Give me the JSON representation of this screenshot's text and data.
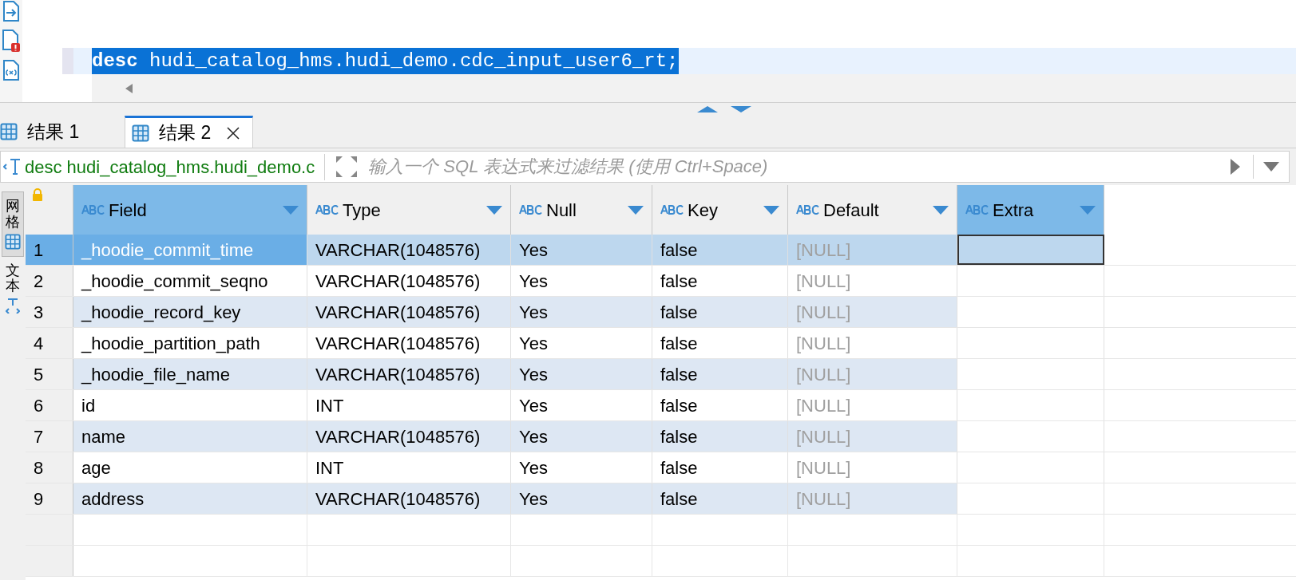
{
  "editor": {
    "keyword": "desc",
    "text": "hudi_catalog_hms.hudi_demo.cdc_input_user6_rt;",
    "selected": true
  },
  "result_tabs": [
    {
      "label": "结果 1",
      "selected": false
    },
    {
      "label": "结果 2",
      "selected": true
    }
  ],
  "filter": {
    "query": "desc hudi_catalog_hms.hudi_demo.c",
    "placeholder": "输入一个 SQL 表达式来过滤结果 (使用 Ctrl+Space)"
  },
  "view_tabs": [
    {
      "label": "网格",
      "selected": true
    },
    {
      "label": "文本",
      "selected": false
    }
  ],
  "table": {
    "columns": [
      {
        "label": "Field",
        "selected": true
      },
      {
        "label": "Type",
        "selected": false
      },
      {
        "label": "Null",
        "selected": false
      },
      {
        "label": "Key",
        "selected": false
      },
      {
        "label": "Default",
        "selected": false
      },
      {
        "label": "Extra",
        "selected": true
      }
    ],
    "rows": [
      {
        "number": "1",
        "selected": true,
        "cells": [
          "_hoodie_commit_time",
          "VARCHAR(1048576)",
          "Yes",
          "false",
          {
            "text": "[NULL]",
            "null": true
          }
        ]
      },
      {
        "number": "2",
        "selected": false,
        "cells": [
          "_hoodie_commit_seqno",
          "VARCHAR(1048576)",
          "Yes",
          "false",
          {
            "text": "[NULL]",
            "null": true
          }
        ]
      },
      {
        "number": "3",
        "selected": false,
        "cells": [
          "_hoodie_record_key",
          "VARCHAR(1048576)",
          "Yes",
          "false",
          {
            "text": "[NULL]",
            "null": true
          }
        ]
      },
      {
        "number": "4",
        "selected": false,
        "cells": [
          "_hoodie_partition_path",
          "VARCHAR(1048576)",
          "Yes",
          "false",
          {
            "text": "[NULL]",
            "null": true
          }
        ]
      },
      {
        "number": "5",
        "selected": false,
        "cells": [
          "_hoodie_file_name",
          "VARCHAR(1048576)",
          "Yes",
          "false",
          {
            "text": "[NULL]",
            "null": true
          }
        ]
      },
      {
        "number": "6",
        "selected": false,
        "cells": [
          "id",
          "INT",
          "Yes",
          "false",
          {
            "text": "[NULL]",
            "null": true
          }
        ]
      },
      {
        "number": "7",
        "selected": false,
        "cells": [
          "name",
          "VARCHAR(1048576)",
          "Yes",
          "false",
          {
            "text": "[NULL]",
            "null": true
          }
        ]
      },
      {
        "number": "8",
        "selected": false,
        "cells": [
          "age",
          "INT",
          "Yes",
          "false",
          {
            "text": "[NULL]",
            "null": true
          }
        ]
      },
      {
        "number": "9",
        "selected": false,
        "cells": [
          "address",
          "VARCHAR(1048576)",
          "Yes",
          "false",
          {
            "text": "[NULL]",
            "null": true
          }
        ]
      }
    ]
  }
}
